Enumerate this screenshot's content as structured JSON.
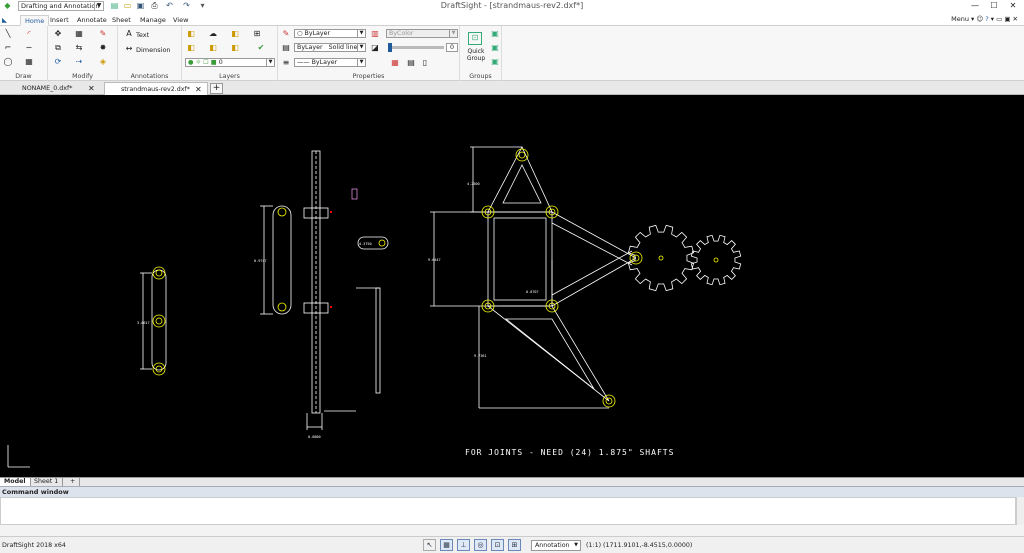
{
  "titlebar": {
    "workspace": "Drafting and Annotation",
    "title": "DraftSight - [strandmaus-rev2.dxf*]"
  },
  "ribbon_tabs": [
    "Home",
    "Insert",
    "Annotate",
    "Sheet",
    "Manage",
    "View"
  ],
  "menu_label": "Menu",
  "ribbon": {
    "groups": [
      "Draw",
      "Modify",
      "Annotations",
      "Layers",
      "Properties",
      "Groups"
    ],
    "text_button": "Text",
    "dimension_button": "Dimension",
    "layer_value": "0",
    "color_value": "ByLayer",
    "color_by_color": "ByColor",
    "linetype_layer": "ByLayer",
    "linetype_value": "Solid line",
    "lineweight_value": "ByLayer",
    "transparency_value": "0",
    "quick_group": "Quick Group"
  },
  "doc_tabs": [
    {
      "label": "NONAME_0.dxf*",
      "close": "✕"
    },
    {
      "label": "strandmaus-rev2.dxf*",
      "close": "✕"
    }
  ],
  "viewport": {
    "note": "FOR JOINTS - NEED (24) 1.875\" SHAFTS",
    "dims": [
      "3.0617",
      "0.9747",
      "0.0800",
      "4.3750",
      "9.6447",
      "0.8707",
      "9.7361",
      "4.2500"
    ]
  },
  "sheet_tabs": [
    "Model",
    "Sheet 1",
    "+"
  ],
  "command_window": "Command window",
  "status": {
    "app_version": "DraftSight 2018 x64",
    "annotation": "Annotation",
    "scale": "(1:1)",
    "coords": "(1711.9101,-8.4515,0.0000)"
  },
  "colors": {
    "canvas": "#000000",
    "geometry": "#ffffff",
    "holes": "#ffff00",
    "accent": "#1f5a9c"
  }
}
